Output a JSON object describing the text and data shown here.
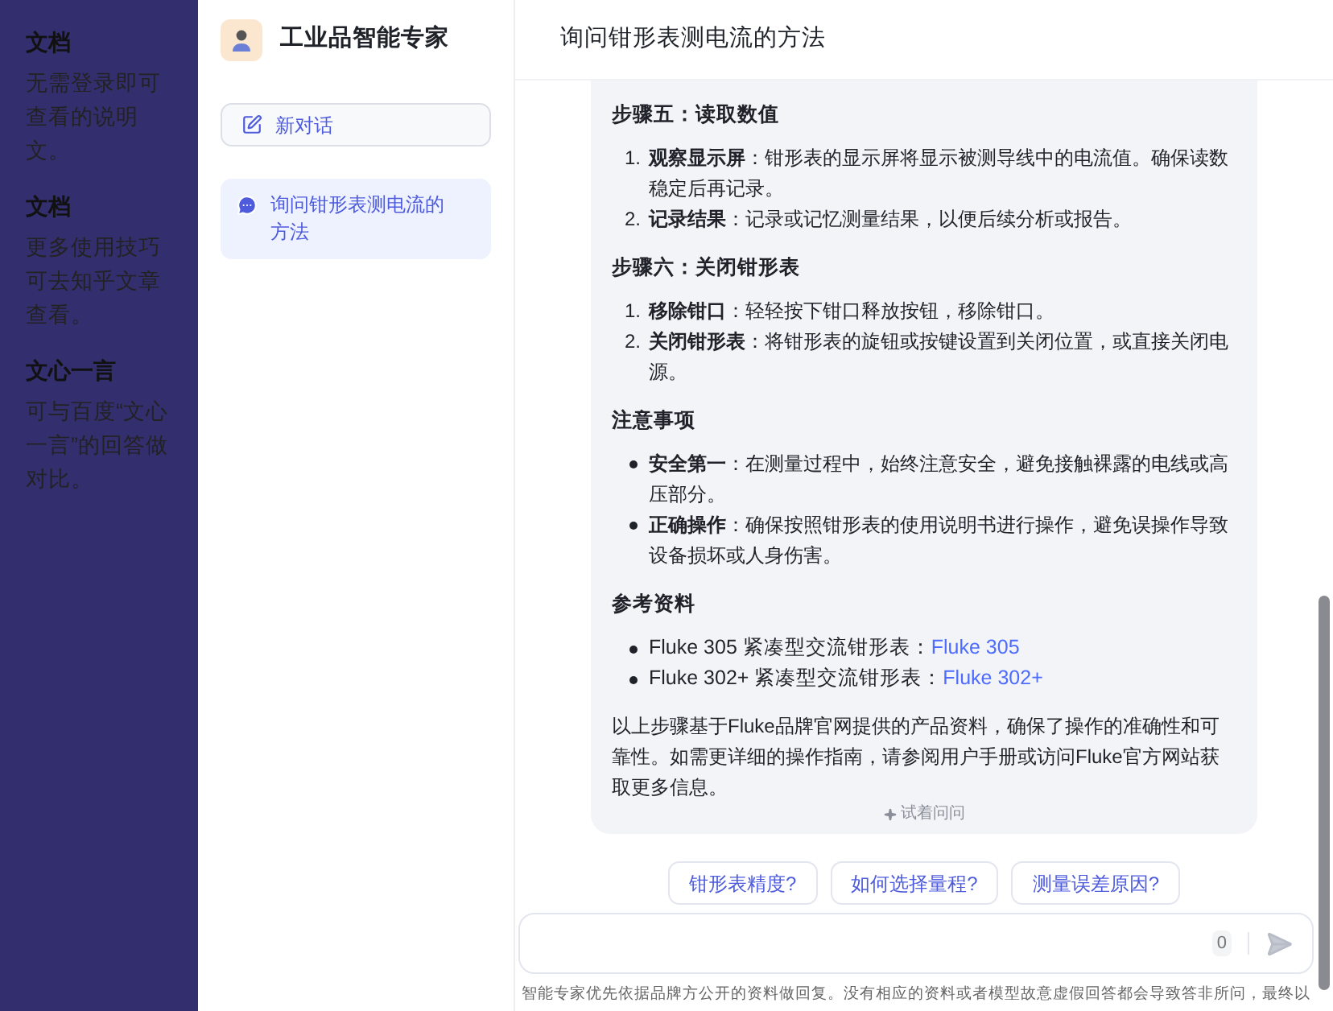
{
  "info_sidebar": {
    "sections": [
      {
        "title": "文档",
        "text": "无需登录即可查看的说明文。"
      },
      {
        "title": "文档",
        "text": "更多使用技巧可去知乎文章查看。"
      },
      {
        "title": "文心一言",
        "text": "可与百度“文心一言”的回答做对比。"
      }
    ]
  },
  "app": {
    "name": "工业品智能专家"
  },
  "new_chat_button": "新对话",
  "conversations": [
    {
      "title": "询问钳形表测电流的方法",
      "selected": true
    }
  ],
  "chat": {
    "title": "询问钳形表测电流的方法",
    "message": [
      {
        "kind": "heading",
        "text": "步骤五：读取数值"
      },
      {
        "kind": "ordered_list",
        "items": [
          {
            "number": "1.",
            "text": "**观察显示屏**：钳形表的显示屏将显示被测导线中的电流值。确保读数稳定后再记录。"
          },
          {
            "number": "2.",
            "text": "**记录结果**：记录或记忆测量结果，以便后续分析或报告。"
          }
        ]
      },
      {
        "kind": "heading",
        "text": "步骤六：关闭钳形表"
      },
      {
        "kind": "ordered_list",
        "items": [
          {
            "number": "1.",
            "text": "**移除钳口**：轻轻按下钳口释放按钮，移除钳口。"
          },
          {
            "number": "2.",
            "text": "**关闭钳形表**：将钳形表的旋钮或按键设置到关闭位置，或直接关闭电源。"
          }
        ]
      },
      {
        "kind": "heading",
        "text": "注意事项"
      },
      {
        "kind": "bullet_list",
        "items": [
          "**安全第一**：在测量过程中，始终注意安全，避免接触裸露的电线或高压部分。",
          "**正确操作**：确保按照钳形表的使用说明书进行操作，避免误操作导致设备损坏或人身伤害。"
        ]
      },
      {
        "kind": "heading",
        "text": "参考资料"
      },
      {
        "kind": "link_list",
        "items": [
          {
            "text": "Fluke 305 紧凑型交流钳形表：",
            "link": "Fluke 305"
          },
          {
            "text": "Fluke 302+ 紧凑型交流钳形表：",
            "link": "Fluke 302+"
          }
        ]
      },
      {
        "kind": "paragraph",
        "text": "以上步骤基于Fluke品牌官网提供的产品资料，确保了操作的准确性和可靠性。如需更详细的操作指南，请参阅用户手册或访问Fluke官方网站获取更多信息。"
      }
    ],
    "try_asking": "试着问问",
    "suggestions": [
      "钳形表精度?",
      "如何选择量程?",
      "测量误差原因?"
    ],
    "input": {
      "counter": "0"
    },
    "footer": "智能专家优先依据品牌方公开的资料做回复。没有相应的资料或者模型故意虚假回答都会导致答非所问，最终以"
  }
}
